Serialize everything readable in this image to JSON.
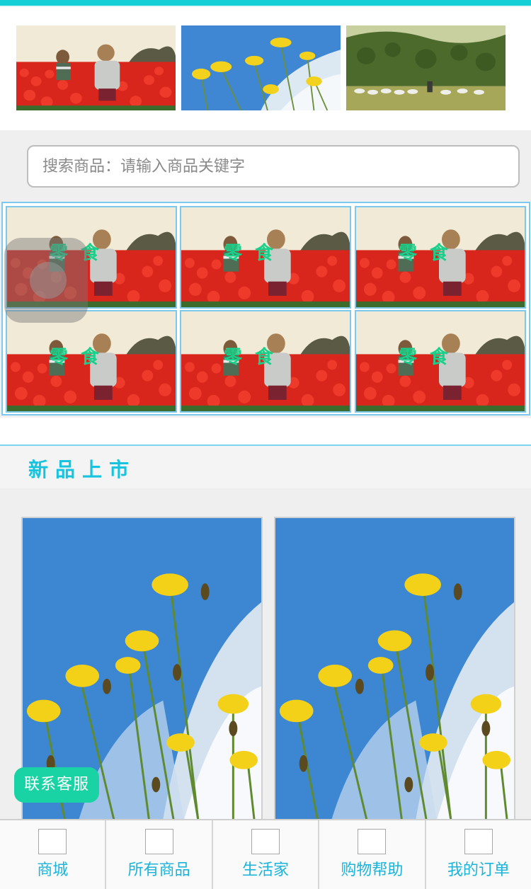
{
  "banner": {
    "images": [
      "girls-in-tulip-field-photo",
      "yellow-flowers-sky-photo",
      "shepherd-meadow-photo"
    ]
  },
  "search": {
    "placeholder": "搜索商品：请输入商品关键字"
  },
  "categories": [
    {
      "label": "零食"
    },
    {
      "label": "零食"
    },
    {
      "label": "零食"
    },
    {
      "label": "零食"
    },
    {
      "label": "零食"
    },
    {
      "label": "零食"
    }
  ],
  "section": {
    "title": "新品上市"
  },
  "products": [
    {
      "image": "yellow-flowers-photo"
    },
    {
      "image": "yellow-flowers-photo"
    }
  ],
  "contact": {
    "label": "联系客服"
  },
  "bottom_nav": [
    {
      "label": "商城",
      "icon": "shop-icon"
    },
    {
      "label": "所有商品",
      "icon": "all-products-icon"
    },
    {
      "label": "生活家",
      "icon": "life-icon"
    },
    {
      "label": "购物帮助",
      "icon": "help-icon"
    },
    {
      "label": "我的订单",
      "icon": "orders-icon"
    }
  ],
  "colors": {
    "accent": "#14cfd5",
    "category_label": "#19d08a",
    "nav_text": "#1cb4da",
    "contact_button": "#19d3a4"
  }
}
